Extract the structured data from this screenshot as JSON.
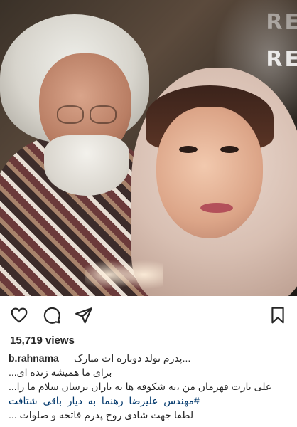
{
  "post": {
    "views_label": "15,719 views",
    "username": "b.rahnama",
    "caption_lines": [
      "...پدرم تولد دوباره ات مبارک",
      "برای ما همیشه زنده ای...",
      "علی یارت قهرمان من ،به شکوفه ها به باران برسان سلام ما را...",
      "لطفا جهت شادی روح پدرم فاتحه و صلوات ..."
    ],
    "hashtag_line": "#مهندس_علیرضا_رهنما_به_دیار_باقی_شتافت",
    "photo_sign_text": [
      "RE",
      "RE"
    ]
  },
  "icons": {
    "like": "heart-icon",
    "comment": "comment-icon",
    "share": "share-icon",
    "save": "bookmark-icon"
  },
  "colors": {
    "text": "#262626",
    "hashtag": "#00376b",
    "background": "#ffffff"
  }
}
